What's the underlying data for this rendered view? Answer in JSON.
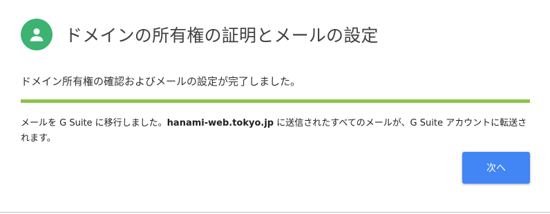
{
  "header": {
    "title": "ドメインの所有権の証明とメールの設定",
    "icon": "person-icon",
    "icon_color": "#3cb371"
  },
  "status": {
    "subtitle": "ドメイン所有権の確認およびメールの設定が完了しました。",
    "progress_fraction": 1.0,
    "progress_color": "#8bc34a"
  },
  "message": {
    "text_before": "メールを G Suite に移行しました。",
    "domain": "hanami-web.tokyo.jp",
    "text_after": " に送信されたすべてのメールが、G Suite アカウントに転送されます。"
  },
  "actions": {
    "next_label": "次へ",
    "next_color": "#4285f4"
  }
}
